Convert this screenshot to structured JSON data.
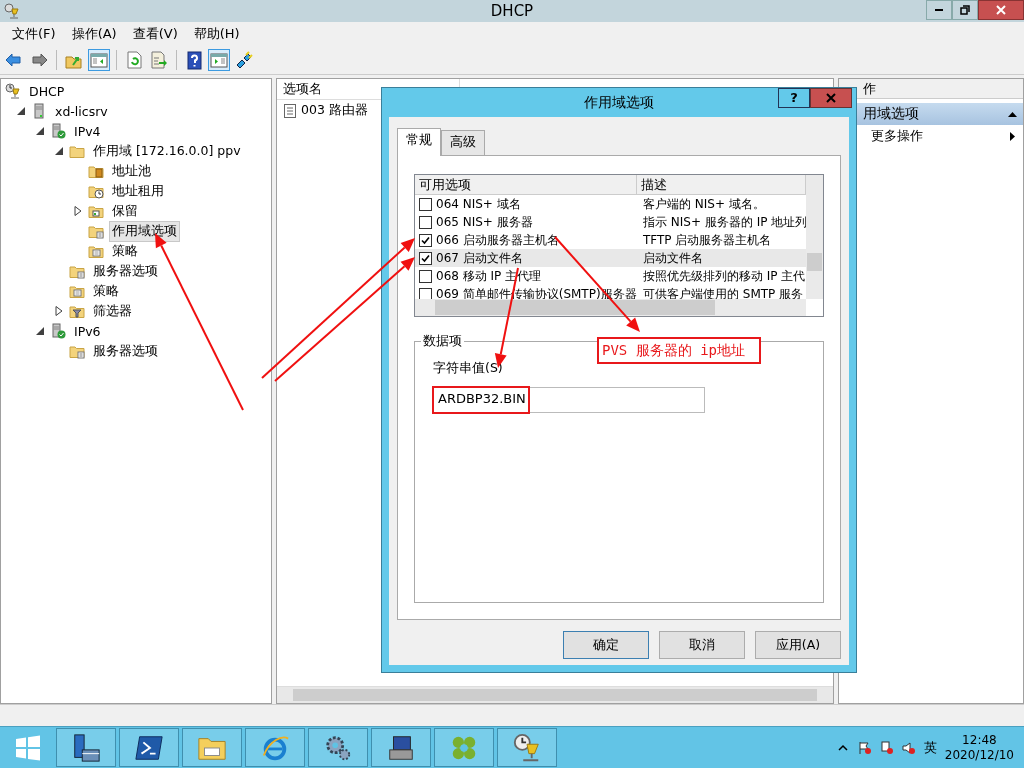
{
  "window": {
    "title": "DHCP"
  },
  "menu": [
    "文件(F)",
    "操作(A)",
    "查看(V)",
    "帮助(H)"
  ],
  "toolbar": [
    {
      "kind": "back",
      "on": false
    },
    {
      "kind": "forward",
      "on": false
    },
    {
      "kind": "up",
      "on": false
    },
    {
      "kind": "tree-pane",
      "on": true
    },
    {
      "kind": "refresh",
      "on": false
    },
    {
      "kind": "export",
      "on": false
    },
    {
      "kind": "help",
      "on": false
    },
    {
      "kind": "action-pane",
      "on": true
    },
    {
      "kind": "plug",
      "on": false
    }
  ],
  "tree": [
    {
      "label": "DHCP",
      "kind": "dhcp",
      "selected": false,
      "children": [
        {
          "label": "xd-licsrv",
          "kind": "server",
          "expanded": true,
          "selected": false,
          "children": [
            {
              "label": "IPv4",
              "kind": "ip",
              "expanded": true,
              "selected": false,
              "children": [
                {
                  "label": "作用域 [172.16.0.0] ppv",
                  "kind": "folder",
                  "expanded": true,
                  "selected": false,
                  "children": [
                    {
                      "label": "地址池",
                      "kind": "pool",
                      "selected": false
                    },
                    {
                      "label": "地址租用",
                      "kind": "lease",
                      "selected": false
                    },
                    {
                      "label": "保留",
                      "kind": "reservation",
                      "expanded": false,
                      "selected": false
                    },
                    {
                      "label": "作用域选项",
                      "kind": "options",
                      "selected": true
                    },
                    {
                      "label": "策略",
                      "kind": "policy",
                      "selected": false
                    }
                  ]
                },
                {
                  "label": "服务器选项",
                  "kind": "options",
                  "selected": false
                },
                {
                  "label": "策略",
                  "kind": "policy",
                  "selected": false
                },
                {
                  "label": "筛选器",
                  "kind": "filter",
                  "expanded": false,
                  "selected": false
                }
              ]
            },
            {
              "label": "IPv6",
              "kind": "ip",
              "expanded": true,
              "selected": false,
              "children": [
                {
                  "label": "服务器选项",
                  "kind": "options",
                  "selected": false
                }
              ]
            }
          ]
        }
      ]
    }
  ],
  "list": {
    "columns": [
      "选项名"
    ],
    "rows": [
      "003 路由器"
    ]
  },
  "actions": {
    "title": "作",
    "section": "用域选项",
    "items": [
      "更多操作"
    ]
  },
  "dialog": {
    "title": "作用域选项",
    "help_button": "?",
    "tabs": [
      {
        "label": "常规",
        "selected": true
      },
      {
        "label": "高级",
        "selected": false
      }
    ],
    "columns": [
      "可用选项",
      "描述"
    ],
    "options": [
      {
        "name": "064 NIS+ 域名",
        "description": "客户端的 NIS+ 域名。",
        "checked": false,
        "selected": false
      },
      {
        "name": "065 NIS+ 服务器",
        "description": "指示 NIS+ 服务器的 IP 地址列",
        "checked": false,
        "selected": false
      },
      {
        "name": "066 启动服务器主机名",
        "description": "TFTP 启动服务器主机名",
        "checked": true,
        "selected": false
      },
      {
        "name": "067 启动文件名",
        "description": "启动文件名",
        "checked": true,
        "selected": true
      },
      {
        "name": "068 移动 IP 主代理",
        "description": "按照优先级排列的移动 IP 主代",
        "checked": false,
        "selected": false
      },
      {
        "name": "069 简单邮件传输协议(SMTP)服务器",
        "description": "可供客户端使用的 SMTP 服务",
        "checked": false,
        "selected": false
      }
    ],
    "group": "数据项",
    "field_label": "字符串值(S)",
    "value": "ARDBP32.BIN",
    "buttons": [
      {
        "label": "确定",
        "default": true
      },
      {
        "label": "取消",
        "default": false
      },
      {
        "label": "应用(A)",
        "default": false
      }
    ]
  },
  "annotation": {
    "label": "PVS 服务器的 ip地址"
  },
  "taskbar": {
    "apps": [
      {
        "kind": "server-manager"
      },
      {
        "kind": "terminal"
      },
      {
        "kind": "explorer"
      },
      {
        "kind": "browser"
      },
      {
        "kind": "gears"
      },
      {
        "kind": "computer"
      },
      {
        "kind": "knot"
      },
      {
        "kind": "dhcp"
      }
    ],
    "language": "英",
    "time": "12:48",
    "date": "2020/12/10"
  }
}
